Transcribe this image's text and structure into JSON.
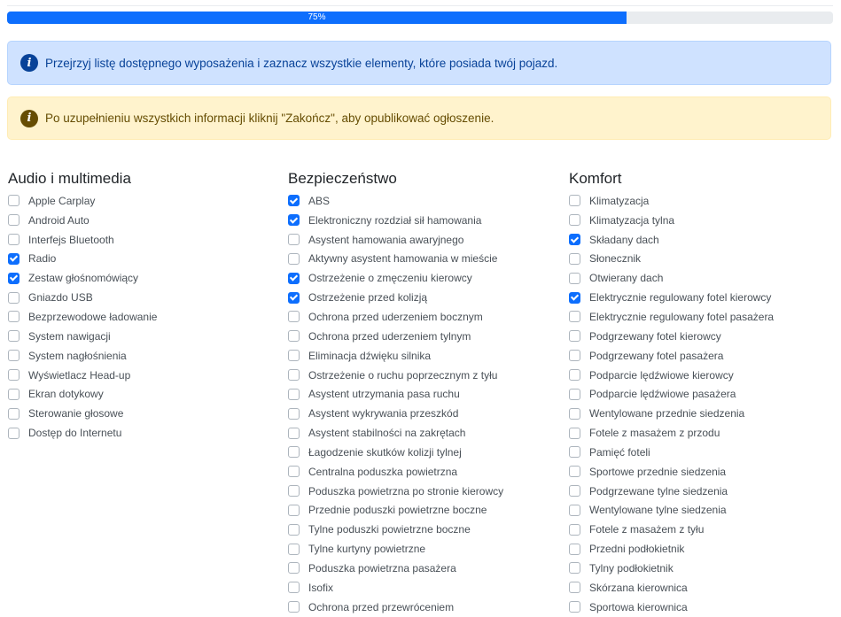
{
  "progress": {
    "label": "75%",
    "value": 75
  },
  "alerts": {
    "info": "Przejrzyj listę dostępnego wyposażenia i zaznacz wszystkie elementy, które posiada twój pojazd.",
    "warning": "Po uzupełnieniu wszystkich informacji kliknij \"Zakończ\", aby opublikować ogłoszenie."
  },
  "columns": [
    {
      "title": "Audio i multimedia",
      "items": [
        {
          "label": "Apple Carplay",
          "checked": false
        },
        {
          "label": "Android Auto",
          "checked": false
        },
        {
          "label": "Interfejs Bluetooth",
          "checked": false
        },
        {
          "label": "Radio",
          "checked": true
        },
        {
          "label": "Zestaw głośnomówiący",
          "checked": true
        },
        {
          "label": "Gniazdo USB",
          "checked": false
        },
        {
          "label": "Bezprzewodowe ładowanie",
          "checked": false
        },
        {
          "label": "System nawigacji",
          "checked": false
        },
        {
          "label": "System nagłośnienia",
          "checked": false
        },
        {
          "label": "Wyświetlacz Head-up",
          "checked": false
        },
        {
          "label": "Ekran dotykowy",
          "checked": false
        },
        {
          "label": "Sterowanie głosowe",
          "checked": false
        },
        {
          "label": "Dostęp do Internetu",
          "checked": false
        }
      ]
    },
    {
      "title": "Bezpieczeństwo",
      "items": [
        {
          "label": "ABS",
          "checked": true
        },
        {
          "label": "Elektroniczny rozdział sił hamowania",
          "checked": true
        },
        {
          "label": "Asystent hamowania awaryjnego",
          "checked": false
        },
        {
          "label": "Aktywny asystent hamowania w mieście",
          "checked": false
        },
        {
          "label": "Ostrzeżenie o zmęczeniu kierowcy",
          "checked": true
        },
        {
          "label": "Ostrzeżenie przed kolizją",
          "checked": true
        },
        {
          "label": "Ochrona przed uderzeniem bocznym",
          "checked": false
        },
        {
          "label": "Ochrona przed uderzeniem tylnym",
          "checked": false
        },
        {
          "label": "Eliminacja dźwięku silnika",
          "checked": false
        },
        {
          "label": "Ostrzeżenie o ruchu poprzecznym z tyłu",
          "checked": false
        },
        {
          "label": "Asystent utrzymania pasa ruchu",
          "checked": false
        },
        {
          "label": "Asystent wykrywania przeszkód",
          "checked": false
        },
        {
          "label": "Asystent stabilności na zakrętach",
          "checked": false
        },
        {
          "label": "Łagodzenie skutków kolizji tylnej",
          "checked": false
        },
        {
          "label": "Centralna poduszka powietrzna",
          "checked": false
        },
        {
          "label": "Poduszka powietrzna po stronie kierowcy",
          "checked": false
        },
        {
          "label": "Przednie poduszki powietrzne boczne",
          "checked": false
        },
        {
          "label": "Tylne poduszki powietrzne boczne",
          "checked": false
        },
        {
          "label": "Tylne kurtyny powietrzne",
          "checked": false
        },
        {
          "label": "Poduszka powietrzna pasażera",
          "checked": false
        },
        {
          "label": "Isofix",
          "checked": false
        },
        {
          "label": "Ochrona przed przewróceniem",
          "checked": false
        }
      ]
    },
    {
      "title": "Komfort",
      "items": [
        {
          "label": "Klimatyzacja",
          "checked": false
        },
        {
          "label": "Klimatyzacja tylna",
          "checked": false
        },
        {
          "label": "Składany dach",
          "checked": true
        },
        {
          "label": "Słonecznik",
          "checked": false
        },
        {
          "label": "Otwierany dach",
          "checked": false
        },
        {
          "label": "Elektrycznie regulowany fotel kierowcy",
          "checked": true
        },
        {
          "label": "Elektrycznie regulowany fotel pasażera",
          "checked": false
        },
        {
          "label": "Podgrzewany fotel kierowcy",
          "checked": false
        },
        {
          "label": "Podgrzewany fotel pasażera",
          "checked": false
        },
        {
          "label": "Podparcie lędźwiowe kierowcy",
          "checked": false
        },
        {
          "label": "Podparcie lędźwiowe pasażera",
          "checked": false
        },
        {
          "label": "Wentylowane przednie siedzenia",
          "checked": false
        },
        {
          "label": "Fotele z masażem z przodu",
          "checked": false
        },
        {
          "label": "Pamięć foteli",
          "checked": false
        },
        {
          "label": "Sportowe przednie siedzenia",
          "checked": false
        },
        {
          "label": "Podgrzewane tylne siedzenia",
          "checked": false
        },
        {
          "label": "Wentylowane tylne siedzenia",
          "checked": false
        },
        {
          "label": "Fotele z masażem z tyłu",
          "checked": false
        },
        {
          "label": "Przedni podłokietnik",
          "checked": false
        },
        {
          "label": "Tylny podłokietnik",
          "checked": false
        },
        {
          "label": "Skórzana kierownica",
          "checked": false
        },
        {
          "label": "Sportowa kierownica",
          "checked": false
        }
      ]
    }
  ]
}
